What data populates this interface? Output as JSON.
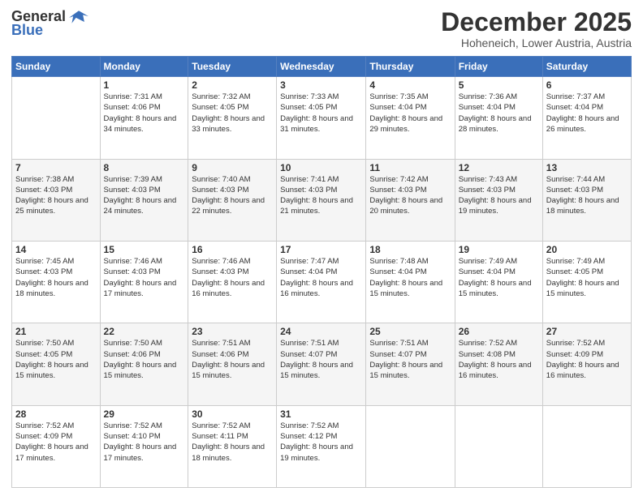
{
  "logo": {
    "general": "General",
    "blue": "Blue"
  },
  "header": {
    "month": "December 2025",
    "location": "Hoheneich, Lower Austria, Austria"
  },
  "weekdays": [
    "Sunday",
    "Monday",
    "Tuesday",
    "Wednesday",
    "Thursday",
    "Friday",
    "Saturday"
  ],
  "weeks": [
    [
      {
        "day": "",
        "sunrise": "",
        "sunset": "",
        "daylight": ""
      },
      {
        "day": "1",
        "sunrise": "Sunrise: 7:31 AM",
        "sunset": "Sunset: 4:06 PM",
        "daylight": "Daylight: 8 hours and 34 minutes."
      },
      {
        "day": "2",
        "sunrise": "Sunrise: 7:32 AM",
        "sunset": "Sunset: 4:05 PM",
        "daylight": "Daylight: 8 hours and 33 minutes."
      },
      {
        "day": "3",
        "sunrise": "Sunrise: 7:33 AM",
        "sunset": "Sunset: 4:05 PM",
        "daylight": "Daylight: 8 hours and 31 minutes."
      },
      {
        "day": "4",
        "sunrise": "Sunrise: 7:35 AM",
        "sunset": "Sunset: 4:04 PM",
        "daylight": "Daylight: 8 hours and 29 minutes."
      },
      {
        "day": "5",
        "sunrise": "Sunrise: 7:36 AM",
        "sunset": "Sunset: 4:04 PM",
        "daylight": "Daylight: 8 hours and 28 minutes."
      },
      {
        "day": "6",
        "sunrise": "Sunrise: 7:37 AM",
        "sunset": "Sunset: 4:04 PM",
        "daylight": "Daylight: 8 hours and 26 minutes."
      }
    ],
    [
      {
        "day": "7",
        "sunrise": "Sunrise: 7:38 AM",
        "sunset": "Sunset: 4:03 PM",
        "daylight": "Daylight: 8 hours and 25 minutes."
      },
      {
        "day": "8",
        "sunrise": "Sunrise: 7:39 AM",
        "sunset": "Sunset: 4:03 PM",
        "daylight": "Daylight: 8 hours and 24 minutes."
      },
      {
        "day": "9",
        "sunrise": "Sunrise: 7:40 AM",
        "sunset": "Sunset: 4:03 PM",
        "daylight": "Daylight: 8 hours and 22 minutes."
      },
      {
        "day": "10",
        "sunrise": "Sunrise: 7:41 AM",
        "sunset": "Sunset: 4:03 PM",
        "daylight": "Daylight: 8 hours and 21 minutes."
      },
      {
        "day": "11",
        "sunrise": "Sunrise: 7:42 AM",
        "sunset": "Sunset: 4:03 PM",
        "daylight": "Daylight: 8 hours and 20 minutes."
      },
      {
        "day": "12",
        "sunrise": "Sunrise: 7:43 AM",
        "sunset": "Sunset: 4:03 PM",
        "daylight": "Daylight: 8 hours and 19 minutes."
      },
      {
        "day": "13",
        "sunrise": "Sunrise: 7:44 AM",
        "sunset": "Sunset: 4:03 PM",
        "daylight": "Daylight: 8 hours and 18 minutes."
      }
    ],
    [
      {
        "day": "14",
        "sunrise": "Sunrise: 7:45 AM",
        "sunset": "Sunset: 4:03 PM",
        "daylight": "Daylight: 8 hours and 18 minutes."
      },
      {
        "day": "15",
        "sunrise": "Sunrise: 7:46 AM",
        "sunset": "Sunset: 4:03 PM",
        "daylight": "Daylight: 8 hours and 17 minutes."
      },
      {
        "day": "16",
        "sunrise": "Sunrise: 7:46 AM",
        "sunset": "Sunset: 4:03 PM",
        "daylight": "Daylight: 8 hours and 16 minutes."
      },
      {
        "day": "17",
        "sunrise": "Sunrise: 7:47 AM",
        "sunset": "Sunset: 4:04 PM",
        "daylight": "Daylight: 8 hours and 16 minutes."
      },
      {
        "day": "18",
        "sunrise": "Sunrise: 7:48 AM",
        "sunset": "Sunset: 4:04 PM",
        "daylight": "Daylight: 8 hours and 15 minutes."
      },
      {
        "day": "19",
        "sunrise": "Sunrise: 7:49 AM",
        "sunset": "Sunset: 4:04 PM",
        "daylight": "Daylight: 8 hours and 15 minutes."
      },
      {
        "day": "20",
        "sunrise": "Sunrise: 7:49 AM",
        "sunset": "Sunset: 4:05 PM",
        "daylight": "Daylight: 8 hours and 15 minutes."
      }
    ],
    [
      {
        "day": "21",
        "sunrise": "Sunrise: 7:50 AM",
        "sunset": "Sunset: 4:05 PM",
        "daylight": "Daylight: 8 hours and 15 minutes."
      },
      {
        "day": "22",
        "sunrise": "Sunrise: 7:50 AM",
        "sunset": "Sunset: 4:06 PM",
        "daylight": "Daylight: 8 hours and 15 minutes."
      },
      {
        "day": "23",
        "sunrise": "Sunrise: 7:51 AM",
        "sunset": "Sunset: 4:06 PM",
        "daylight": "Daylight: 8 hours and 15 minutes."
      },
      {
        "day": "24",
        "sunrise": "Sunrise: 7:51 AM",
        "sunset": "Sunset: 4:07 PM",
        "daylight": "Daylight: 8 hours and 15 minutes."
      },
      {
        "day": "25",
        "sunrise": "Sunrise: 7:51 AM",
        "sunset": "Sunset: 4:07 PM",
        "daylight": "Daylight: 8 hours and 15 minutes."
      },
      {
        "day": "26",
        "sunrise": "Sunrise: 7:52 AM",
        "sunset": "Sunset: 4:08 PM",
        "daylight": "Daylight: 8 hours and 16 minutes."
      },
      {
        "day": "27",
        "sunrise": "Sunrise: 7:52 AM",
        "sunset": "Sunset: 4:09 PM",
        "daylight": "Daylight: 8 hours and 16 minutes."
      }
    ],
    [
      {
        "day": "28",
        "sunrise": "Sunrise: 7:52 AM",
        "sunset": "Sunset: 4:09 PM",
        "daylight": "Daylight: 8 hours and 17 minutes."
      },
      {
        "day": "29",
        "sunrise": "Sunrise: 7:52 AM",
        "sunset": "Sunset: 4:10 PM",
        "daylight": "Daylight: 8 hours and 17 minutes."
      },
      {
        "day": "30",
        "sunrise": "Sunrise: 7:52 AM",
        "sunset": "Sunset: 4:11 PM",
        "daylight": "Daylight: 8 hours and 18 minutes."
      },
      {
        "day": "31",
        "sunrise": "Sunrise: 7:52 AM",
        "sunset": "Sunset: 4:12 PM",
        "daylight": "Daylight: 8 hours and 19 minutes."
      },
      {
        "day": "",
        "sunrise": "",
        "sunset": "",
        "daylight": ""
      },
      {
        "day": "",
        "sunrise": "",
        "sunset": "",
        "daylight": ""
      },
      {
        "day": "",
        "sunrise": "",
        "sunset": "",
        "daylight": ""
      }
    ]
  ]
}
